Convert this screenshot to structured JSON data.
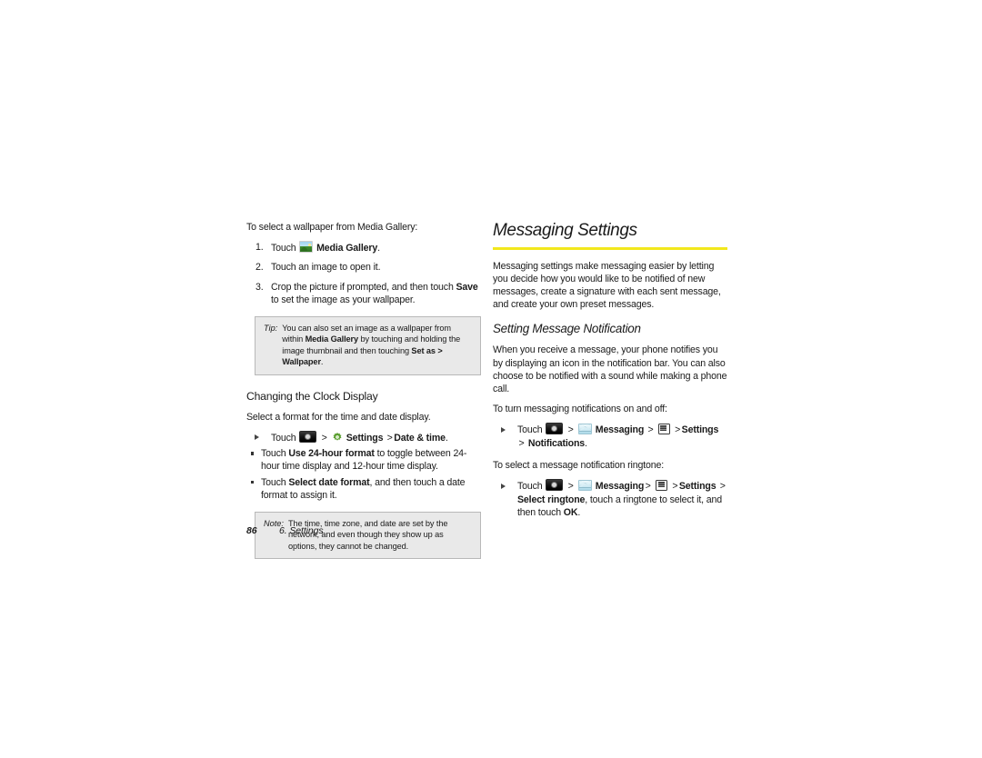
{
  "page": {
    "number": "86",
    "chapter": "6. Settings"
  },
  "left_column": {
    "intro": "To select a wallpaper from Media Gallery:",
    "steps": [
      {
        "num": "1.",
        "pre": "Touch",
        "icon": "media-gallery-icon",
        "bold": "Media Gallery",
        "post": "."
      },
      {
        "num": "2.",
        "text": "Touch an image to open it."
      },
      {
        "num": "3.",
        "pre": "Crop the picture if prompted, and then touch",
        "bold": "Save",
        "post": "to set the image as your wallpaper."
      }
    ],
    "tip": {
      "lead": "Tip:",
      "part1": "You can also set an image as a wallpaper from within",
      "bold1": "Media Gallery",
      "part2": "by touching and holding the image thumbnail and then touching",
      "bold2": "Set as > Wallpaper",
      "part3": "."
    },
    "clock_heading": "Changing the Clock Display",
    "clock_intro": "Select a format for the time and date display.",
    "clock_step": {
      "pre": "Touch",
      "icon1": "launcher-icon",
      "sep1": ">",
      "icon2": "gear-icon",
      "bold1": "Settings",
      "sep2": ">",
      "bold2": "Date & time",
      "post": "."
    },
    "clock_subbullets": [
      {
        "pre": "Touch",
        "bold": "Use 24-hour format",
        "post": "to toggle between 24-hour time display and 12-hour time display."
      },
      {
        "pre": "Touch",
        "bold": "Select date format",
        "post": ", and then touch a date format to assign it."
      }
    ],
    "note": {
      "lead": "Note:",
      "text": "The time, time zone, and date are set by the network, and even though they show up as options, they cannot be changed."
    }
  },
  "right_column": {
    "heading": "Messaging Settings",
    "rule_color": "#f2e81c",
    "intro": "Messaging settings make messaging easier by letting you decide how you would like to be notified of new messages, create a signature with each sent message, and create your own preset messages.",
    "subheading": "Setting Message Notification",
    "para1": "When you receive a message, your phone notifies you by displaying an icon in the notification bar. You can also choose to be notified with a sound while making a phone call.",
    "lead1": "To turn messaging notifications on and off:",
    "step1": {
      "pre": "Touch",
      "icon1": "launcher-icon",
      "sep1": ">",
      "icon2": "messaging-icon",
      "bold1": "Messaging",
      "sep2": ">",
      "icon3": "menu-key-icon",
      "sep3": ">",
      "bold2": "Settings",
      "sep4": ">",
      "bold3": "Notifications",
      "post": "."
    },
    "lead2": "To select a message notification ringtone:",
    "step2": {
      "pre": "Touch",
      "icon1": "launcher-icon",
      "sep1": ">",
      "icon2": "messaging-icon",
      "bold1": "Messaging",
      "sep2": ">",
      "icon3": "menu-key-icon",
      "sep3": ">",
      "bold2": "Settings",
      "sep4": ">",
      "bold3": "Select ringtone",
      "mid": ", touch a ringtone to select it, and then touch",
      "bold4": "OK",
      "post": "."
    }
  }
}
